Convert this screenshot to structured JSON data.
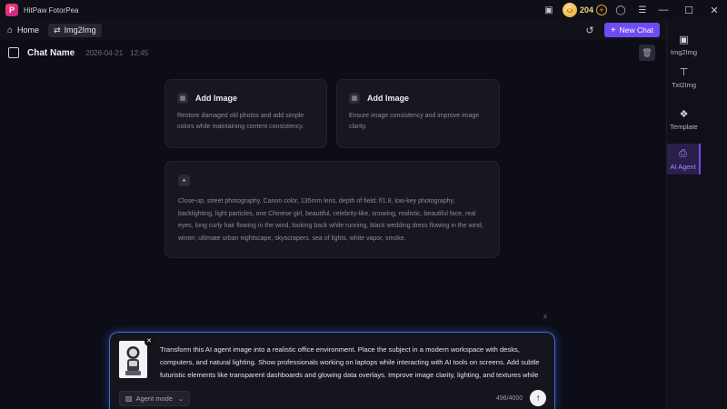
{
  "app": {
    "title": "HitPaw FotorPea",
    "logo_letter": "P"
  },
  "titlebar": {
    "credits": "204"
  },
  "nav": {
    "home_label": "Home",
    "tab_label": "Img2Img",
    "new_chat_label": "New Chat"
  },
  "chat": {
    "name": "Chat Name",
    "date": "2026-04-21",
    "time": "12:45"
  },
  "cards": [
    {
      "title": "Add Image",
      "desc": "Restore damaged old photos and add simple colors while maintaining content consistency."
    },
    {
      "title": "Add Image",
      "desc": "Ensure image consistency and improve image clarity."
    }
  ],
  "prompt_card": {
    "text": "Close-up, street photography, Canon color, 135mm lens, depth of field: f/1.8, low-key photography, backlighting, light particles, one Chinese girl, beautiful, celebrity-like, snowing, realistic, beautiful face, real eyes, long curly hair flowing in the wind, looking back while running, black wedding dress flowing in the wind, winter, ultimate urban nightscape, skyscrapers, sea of lights, white vapor, smoke."
  },
  "input": {
    "text": "Transform this AI agent image into a realistic office environment. Place the subject in a modern workspace with desks, computers, and natural lighting. Show professionals working on laptops while interacting with AI tools on screens. Add subtle futuristic elements like transparent dashboards and glowing data overlays. Improve image clarity, lighting, and textures while keeping the scene clean and professional. Use soft blue and neutral tones, suitable for a business or tech bl",
    "mode_label": "Agent mode",
    "char_count": "496/4000"
  },
  "sidebar": {
    "items": [
      {
        "label": "Img2Img",
        "icon": "image-icon"
      },
      {
        "label": "Txt2Img",
        "icon": "text-image-icon"
      },
      {
        "label": "Template",
        "icon": "template-icon"
      },
      {
        "label": "AI Agent",
        "icon": "ai-agent-icon"
      }
    ]
  },
  "colors": {
    "accent": "#6d4cf6",
    "input_glow": "#3a6fd8",
    "coin": "#e6a52b"
  }
}
